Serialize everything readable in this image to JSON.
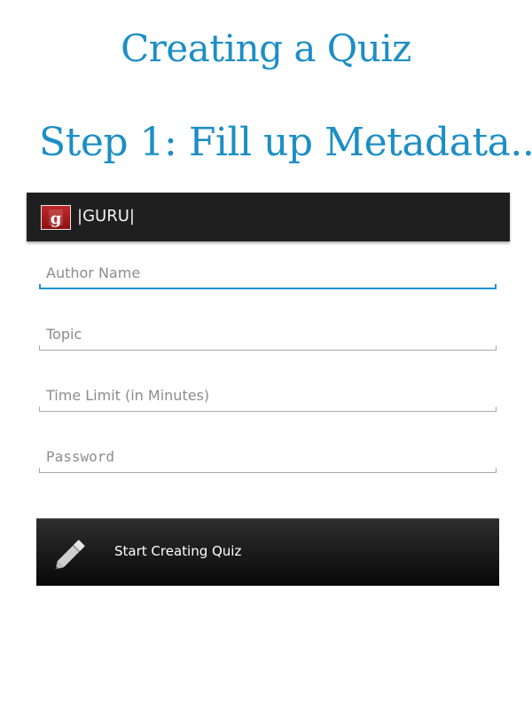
{
  "headings": {
    "title": "Creating a Quiz",
    "step": "Step 1: Fill up Metadata.."
  },
  "app": {
    "title": "|GURU|",
    "logo_letter": "g",
    "actionbar_color": "#1f1f1f"
  },
  "form": {
    "author_placeholder": "Author Name",
    "topic_placeholder": "Topic",
    "time_limit_placeholder": "Time Limit (in Minutes)",
    "password_placeholder": "Password",
    "focus_color": "#1e93cf"
  },
  "start_button": {
    "label": "Start Creating Quiz",
    "icon": "pencil-icon"
  },
  "colors": {
    "heading": "#1c8ec6",
    "logo": "#b01e21"
  }
}
